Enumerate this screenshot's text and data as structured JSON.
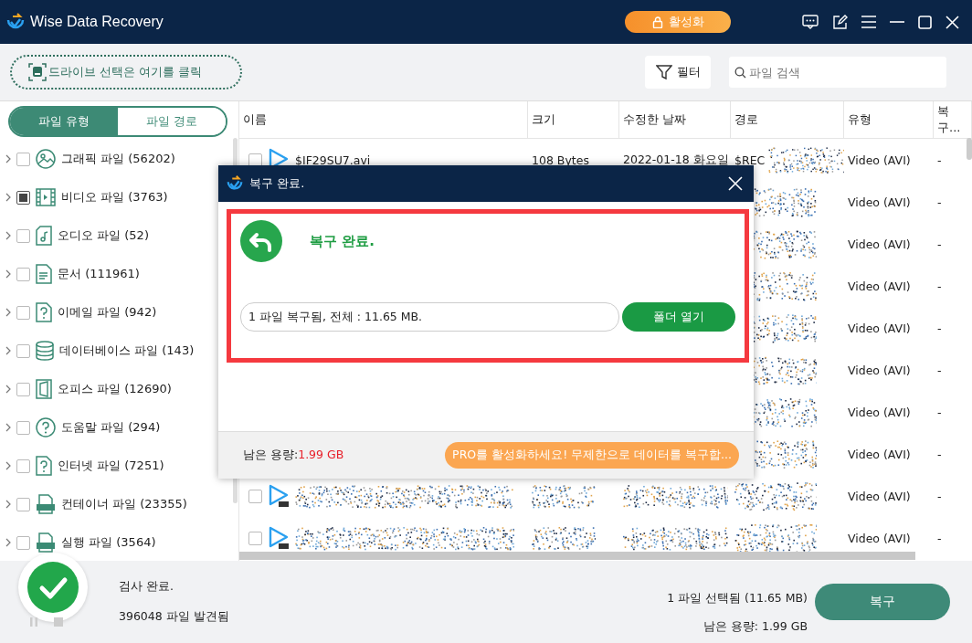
{
  "window": {
    "title": "Wise Data Recovery",
    "activate_label": "활성화"
  },
  "toolbar": {
    "drive_select": "드라이브 선택은 여기를 클릭",
    "filter": "필터",
    "search_placeholder": "파일 검색"
  },
  "sidebar": {
    "tabs": [
      {
        "label": "파일 유형",
        "selected": true
      },
      {
        "label": "파일 경로",
        "selected": false
      }
    ],
    "items": [
      {
        "kind": "image",
        "label": "그래픽 파일 (56202)",
        "checked": false
      },
      {
        "kind": "video",
        "label": "비디오 파일 (3763)",
        "checked": true
      },
      {
        "kind": "audio",
        "label": "오디오 파일 (52)",
        "checked": false
      },
      {
        "kind": "document",
        "label": "문서 (111961)",
        "checked": false
      },
      {
        "kind": "unknown",
        "label": "이메일 파일 (942)",
        "checked": false
      },
      {
        "kind": "database",
        "label": "데이터베이스 파일 (143)",
        "checked": false
      },
      {
        "kind": "office",
        "label": "오피스 파일 (12690)",
        "checked": false
      },
      {
        "kind": "help",
        "label": "도움말 파일 (294)",
        "checked": false
      },
      {
        "kind": "unknown",
        "label": "인터넷 파일 (7251)",
        "checked": false
      },
      {
        "kind": "zip",
        "label": "컨테이너 파일 (23355)",
        "checked": false
      },
      {
        "kind": "program",
        "label": "실행 파일 (3564)",
        "checked": false
      }
    ]
  },
  "table": {
    "columns": [
      "이름",
      "크기",
      "수정한 날짜",
      "경로",
      "유형",
      "복구..."
    ],
    "rows": [
      {
        "obscured": false,
        "checked": false,
        "name": "$IF29SU7.avi",
        "size": "108 Bytes",
        "date": "2022-01-18 화요일",
        "path": "$REC",
        "type": "Video (AVI)",
        "recovered": "-"
      },
      {
        "type": "Video (AVI)",
        "recovered": "-"
      },
      {
        "type": "Video (AVI)",
        "recovered": "-"
      },
      {
        "type": "Video (AVI)",
        "recovered": "-"
      },
      {
        "type": "Video (AVI)",
        "recovered": "-"
      },
      {
        "type": "Video (AVI)",
        "recovered": "-"
      },
      {
        "type": "Video (AVI)",
        "recovered": "-"
      },
      {
        "type": "Video (AVI)",
        "recovered": "-"
      },
      {
        "obscured": true,
        "checked": false,
        "type": "Video (AVI)",
        "recovered": "-"
      },
      {
        "obscured": true,
        "checked": false,
        "type": "Video (AVI)",
        "recovered": "-"
      }
    ]
  },
  "dialog": {
    "title": "복구 완료.",
    "heading": "복구 완료.",
    "summary": "1 파일 복구됨, 전체 : 11.65 MB.",
    "open_folder": "폴더 열기",
    "space_label": "남은 용량:",
    "space_value": "1.99 GB",
    "promo": "PRO를 활성화하세요! 무제한으로 데이터를 복구합..."
  },
  "status_bar": {
    "status": "검사 완료.",
    "found": "396048 파일 발견됨",
    "selected": "1 파일 선택됨 (11.65 MB)",
    "space": "남은 용량: 1.99 GB",
    "recover": "복구"
  }
}
